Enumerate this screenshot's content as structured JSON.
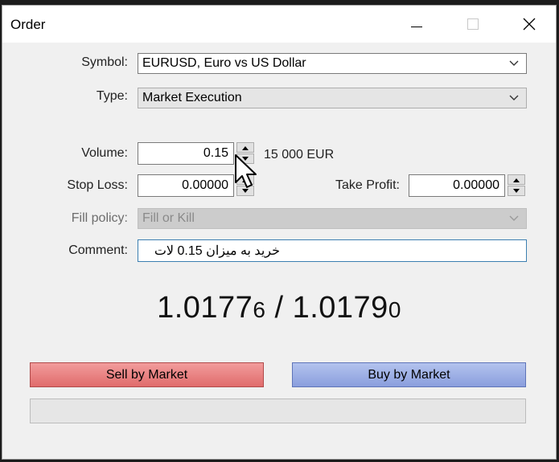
{
  "window": {
    "title": "Order"
  },
  "form": {
    "symbol_label": "Symbol:",
    "symbol_value": "EURUSD, Euro vs US Dollar",
    "type_label": "Type:",
    "type_value": "Market Execution",
    "volume_label": "Volume:",
    "volume_value": "0.15",
    "volume_info": "15 000 EUR",
    "stop_loss_label": "Stop Loss:",
    "stop_loss_value": "0.00000",
    "take_profit_label": "Take Profit:",
    "take_profit_value": "0.00000",
    "fill_policy_label": "Fill policy:",
    "fill_policy_value": "Fill or Kill",
    "comment_label": "Comment:",
    "comment_value": "خرید به میزان 0.15 لات"
  },
  "quote": {
    "bid_main": "1.0177",
    "bid_small": "6",
    "separator": " / ",
    "ask_main": "1.0179",
    "ask_small": "0"
  },
  "buttons": {
    "sell_label": "Sell by Market",
    "buy_label": "Buy by Market"
  },
  "colors": {
    "sell": "#e06c6c",
    "buy": "#8a9edd",
    "comment_border": "#3c7fb1"
  },
  "icons": [
    "minimize-icon",
    "maximize-icon",
    "close-icon",
    "chevron-down-icon",
    "arrow-up-icon",
    "arrow-down-icon",
    "mouse-cursor-icon"
  ]
}
